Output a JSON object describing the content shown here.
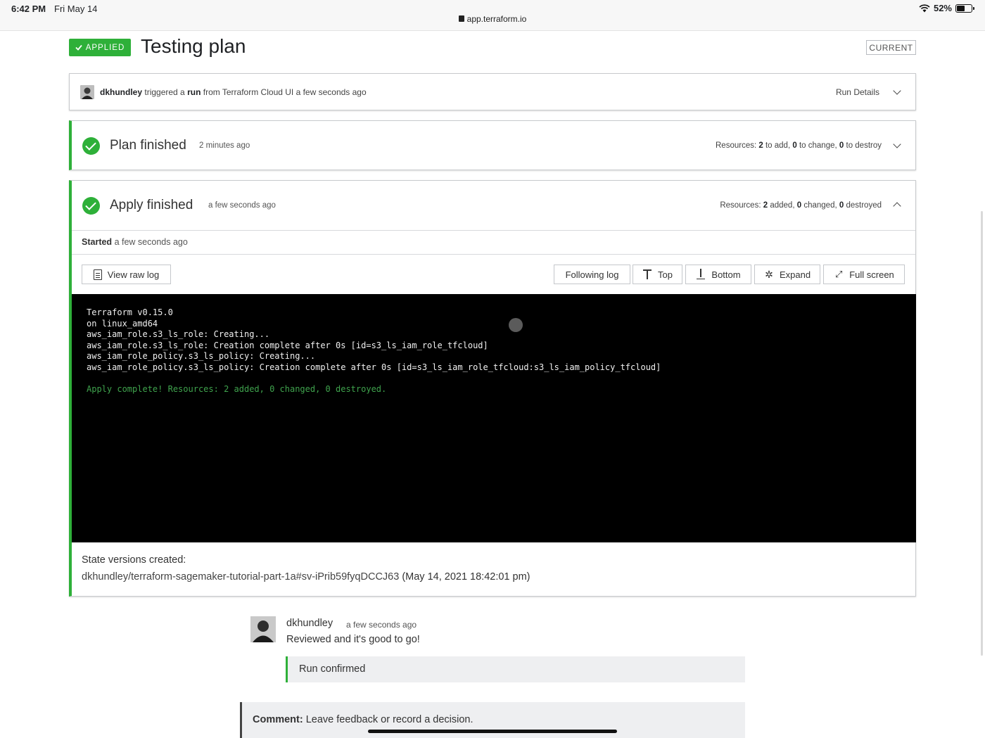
{
  "statusbar": {
    "time": "6:42 PM",
    "date": "Fri May 14",
    "url": "app.terraform.io",
    "battery": "52%"
  },
  "header": {
    "status_badge": "APPLIED",
    "title": "Testing plan",
    "current_badge": "CURRENT"
  },
  "trigger": {
    "user": "dkhundley",
    "triggered": "triggered a",
    "run": "run",
    "source": "from Terraform Cloud UI a few seconds ago",
    "run_details": "Run Details"
  },
  "plan": {
    "title": "Plan finished",
    "ago": "2 minutes ago",
    "resources_label": "Resources:",
    "add": "2",
    "add_label": "to add,",
    "change": "0",
    "change_label": "to change,",
    "destroy": "0",
    "destroy_label": "to destroy"
  },
  "apply": {
    "title": "Apply finished",
    "ago": "a few seconds ago",
    "resources_label": "Resources:",
    "added": "2",
    "added_label": "added,",
    "changed": "0",
    "changed_label": "changed,",
    "destroyed": "0",
    "destroyed_label": "destroyed",
    "started_label": "Started",
    "started_ago": "a few seconds ago",
    "buttons": {
      "view_raw_log": "View raw log",
      "following_log": "Following log",
      "top": "Top",
      "bottom": "Bottom",
      "expand": "Expand",
      "full_screen": "Full screen"
    },
    "log": [
      "Terraform v0.15.0",
      "on linux_amd64",
      "aws_iam_role.s3_ls_role: Creating...",
      "aws_iam_role.s3_ls_role: Creation complete after 0s [id=s3_ls_iam_role_tfcloud]",
      "aws_iam_role_policy.s3_ls_policy: Creating...",
      "aws_iam_role_policy.s3_ls_policy: Creation complete after 0s [id=s3_ls_iam_role_tfcloud:s3_ls_iam_policy_tfcloud]"
    ],
    "log_complete": "Apply complete! Resources: 2 added, 0 changed, 0 destroyed.",
    "state_heading": "State versions created:",
    "state_link": "dkhundley/terraform-sagemaker-tutorial-part-1a#sv-iPrib59fyqDCCJ63",
    "state_date": "(May 14, 2021 18:42:01 pm)"
  },
  "comment": {
    "user": "dkhundley",
    "ago": "a few seconds ago",
    "body": "Reviewed and it's good to go!",
    "run_confirmed": "Run confirmed"
  },
  "comment_box": {
    "label": "Comment:",
    "placeholder": "Leave feedback or record a decision."
  },
  "colors": {
    "accent_green": "#2eb039",
    "terminal_bg": "#000000",
    "log_success": "#3fa34d"
  }
}
